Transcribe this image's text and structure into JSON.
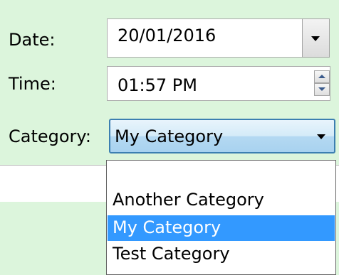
{
  "form": {
    "date": {
      "label": "Date:",
      "value": "20/01/2016"
    },
    "time": {
      "label": "Time:",
      "value": "01:57 PM"
    },
    "category": {
      "label": "Category:",
      "value": "My Category"
    }
  },
  "category_dropdown": {
    "options": [
      "",
      "Another Category",
      "My Category",
      "Test Category"
    ],
    "selected_index": 2
  },
  "colors": {
    "panel_background": "#dcf5dc",
    "selection_highlight": "#3399ff",
    "focus_border": "#3c7fb1"
  }
}
